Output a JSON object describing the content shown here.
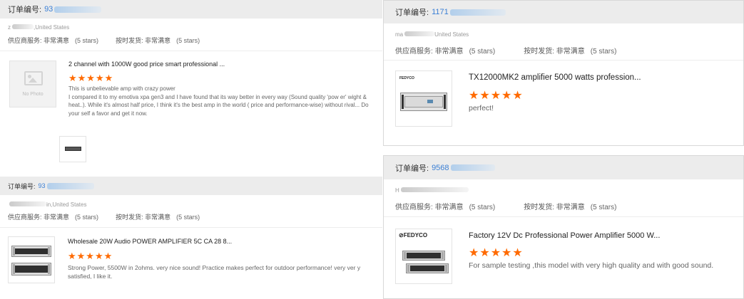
{
  "order_label": "订单编号:",
  "supplier_label": "供应商服务:",
  "ontime_label": "按时发货:",
  "satisfaction": "非常满意",
  "stars_text": "(5 stars)",
  "stars": "★★★★★",
  "colors": {
    "accent": "#ff6a00",
    "link": "#3a7fd5",
    "header_bg": "#ececec"
  },
  "reviews": [
    {
      "order_no": "93",
      "buyer": "z",
      "country": ",United States",
      "title": "2 channel with 1000W good price smart professional ...",
      "review": "This is unbelievable amp with crazy power\nI compared it to my emotiva xpa gen3  and I have found that its way better in every way (Sound quality 'pow er' wight & heat..). While it's almost half price, I think it's the best amp in the world ( price and performance-wise) without rival... Do your self a favor and get it now.",
      "no_photo": "No Photo"
    },
    {
      "order_no": "93",
      "buyer": "",
      "country": "in,United States",
      "title": "Wholesale 20W Audio POWER AMPLIFIER 5C CA 28 8...",
      "review": "Strong Power, 5500W in 2ohms. very nice sound! Practice makes perfect for outdoor performance! very ver y satisfied, I like it."
    },
    {
      "order_no": "1171",
      "buyer": "ma",
      "country": "United States",
      "title": "TX12000MK2 amplifier 5000 watts profession...",
      "review": "perfect!",
      "brand": "FEDYCO"
    },
    {
      "order_no": "9568",
      "buyer": "H",
      "country": "",
      "title": "Factory 12V Dc Professional Power Amplifier 5000 W...",
      "review": "For sample testing ,this model with very high quality and with good sound.",
      "brand": "FEDYCO"
    }
  ]
}
